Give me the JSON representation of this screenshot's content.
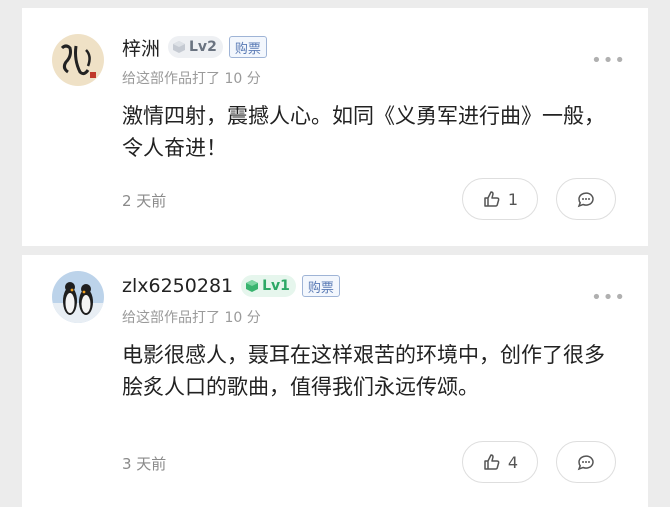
{
  "comments": [
    {
      "username": "梓洲",
      "level": "Lv2",
      "ticket_badge": "购票",
      "rating_text": "给这部作品打了 10 分",
      "text": "激情四射，震撼人心。如同《义勇军进行曲》一般，令人奋进！",
      "time": "2 天前",
      "likes": "1",
      "more_icon": "more-dots-icon",
      "level_color": "#6a7380"
    },
    {
      "username": "zlx6250281",
      "level": "Lv1",
      "ticket_badge": "购票",
      "rating_text": "给这部作品打了 10 分",
      "text": "电影很感人，聂耳在这样艰苦的环境中，创作了很多脍炙人口的歌曲，值得我们永远传颂。",
      "time": "3 天前",
      "likes": "4",
      "more_icon": "more-dots-icon",
      "level_color": "#2da866"
    }
  ]
}
